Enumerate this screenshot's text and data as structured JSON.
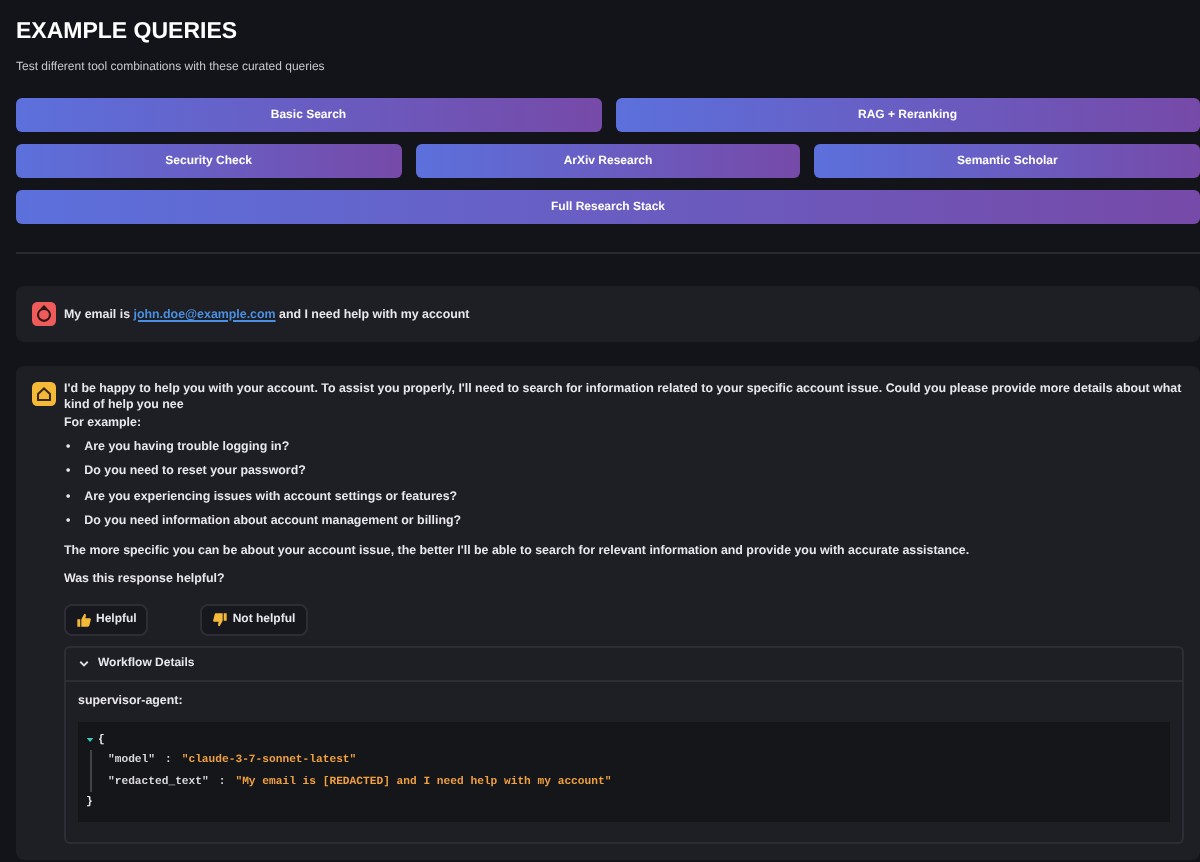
{
  "header": {
    "title": "EXAMPLE QUERIES",
    "subtitle": "Test different tool combinations with these curated queries"
  },
  "query_buttons": [
    [
      "Basic Search",
      "RAG + Reranking"
    ],
    [
      "Security Check",
      "ArXiv Research",
      "Semantic Scholar"
    ],
    [
      "Full Research Stack"
    ]
  ],
  "user_message": {
    "before": "My email is",
    "link": "john.doe@example.com",
    "after": "and I need help with my account"
  },
  "assistant_message": {
    "intro": "I'd be happy to help you with your account. To assist you properly, I'll need to search for information related to your specific account issue. Could you please provide more details about what kind of help you nee",
    "lead": "For example:",
    "bullet_marker": "•",
    "bullets": [
      "Are you having trouble logging in?",
      "Do you need to reset your password?",
      "Are you experiencing issues with account settings or features?",
      "Do you need information about account management or billing?"
    ],
    "closing": "The more specific you can be about your account issue, the better I'll be able to search for relevant information and provide you with accurate assistance.",
    "feedback_question": "Was this response helpful?",
    "feedback_buttons": [
      {
        "kind": "up",
        "label": "Helpful"
      },
      {
        "kind": "down",
        "label": "Not helpful"
      }
    ],
    "workflow": {
      "label": "Workflow Details",
      "expanded": true,
      "agent": "supervisor-agent:",
      "json_expanded": true,
      "open_brace": "{",
      "close_brace": "}",
      "entries": [
        {
          "key": "\"model\"",
          "separator": ":",
          "value": "\"claude-3-7-sonnet-latest\""
        },
        {
          "key": "\"redacted_text\"",
          "separator": ":",
          "value": "\"My email is [REDACTED] and I need help with my account\""
        }
      ]
    }
  }
}
